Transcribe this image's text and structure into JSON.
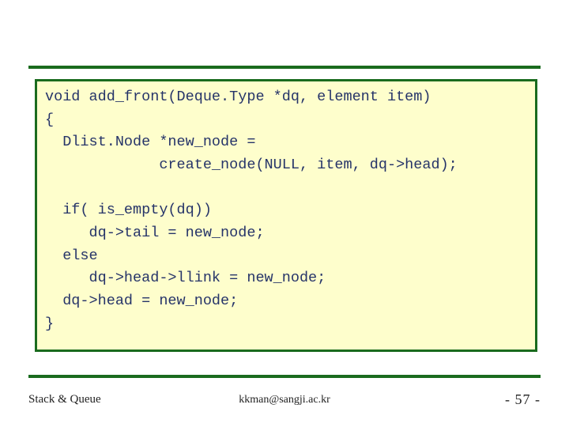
{
  "code": {
    "lines": [
      "void add_front(Deque.Type *dq, element item)",
      "{",
      "  Dlist.Node *new_node =",
      "             create_node(NULL, item, dq->head);",
      "",
      "  if( is_empty(dq))",
      "     dq->tail = new_node;",
      "  else",
      "     dq->head->llink = new_node;",
      "  dq->head = new_node;",
      "}"
    ]
  },
  "footer": {
    "left": "Stack & Queue",
    "center": "kkman@sangji.ac.kr",
    "right": "- 57 -"
  }
}
